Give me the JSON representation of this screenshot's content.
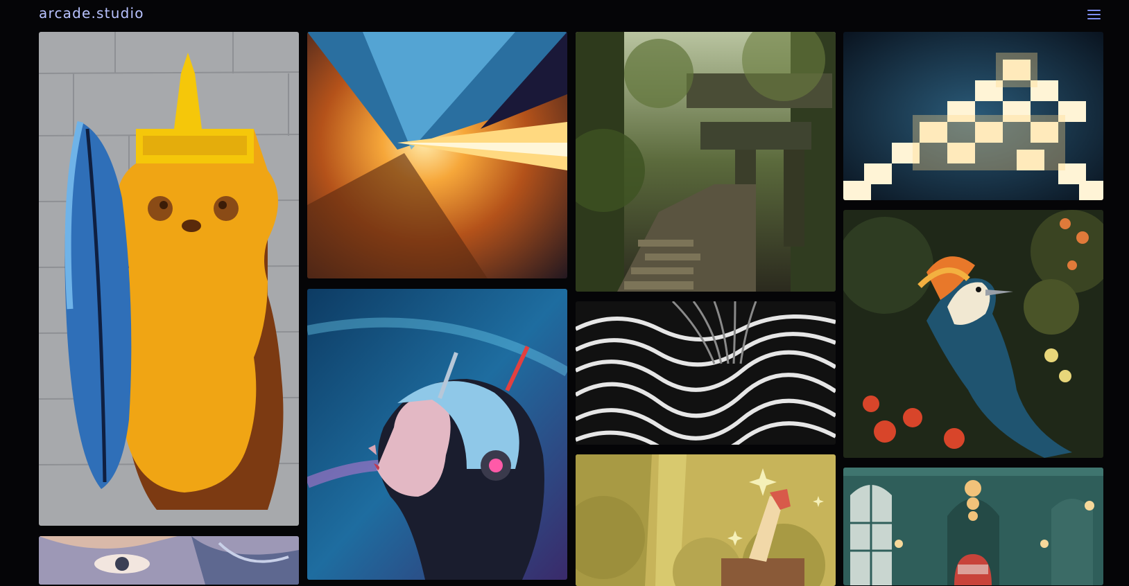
{
  "header": {
    "logo": "arcade.studio",
    "menu_icon": "hamburger-menu-icon"
  },
  "gallery": {
    "tiles": [
      {
        "name": "honey-bear-surfboard-mural",
        "theme": "street art"
      },
      {
        "name": "woman-closeup-portrait",
        "theme": "portrait"
      },
      {
        "name": "light-streak-tunnel",
        "theme": "abstract motion"
      },
      {
        "name": "cyborg-woman-portrait",
        "theme": "sci-fi"
      },
      {
        "name": "jungle-ruins-stairs",
        "theme": "landscape"
      },
      {
        "name": "black-white-wave-pattern",
        "theme": "abstract"
      },
      {
        "name": "golden-sword-illustration",
        "theme": "illustration"
      },
      {
        "name": "glowing-pixel-staircase",
        "theme": "3d render"
      },
      {
        "name": "exotic-bird-flowers",
        "theme": "painting"
      },
      {
        "name": "teal-hallway-astronaut",
        "theme": "interior"
      }
    ]
  },
  "colors": {
    "background": "#050507",
    "logo": "#b8c2ff",
    "menu_icon": "#7f8ff2"
  }
}
